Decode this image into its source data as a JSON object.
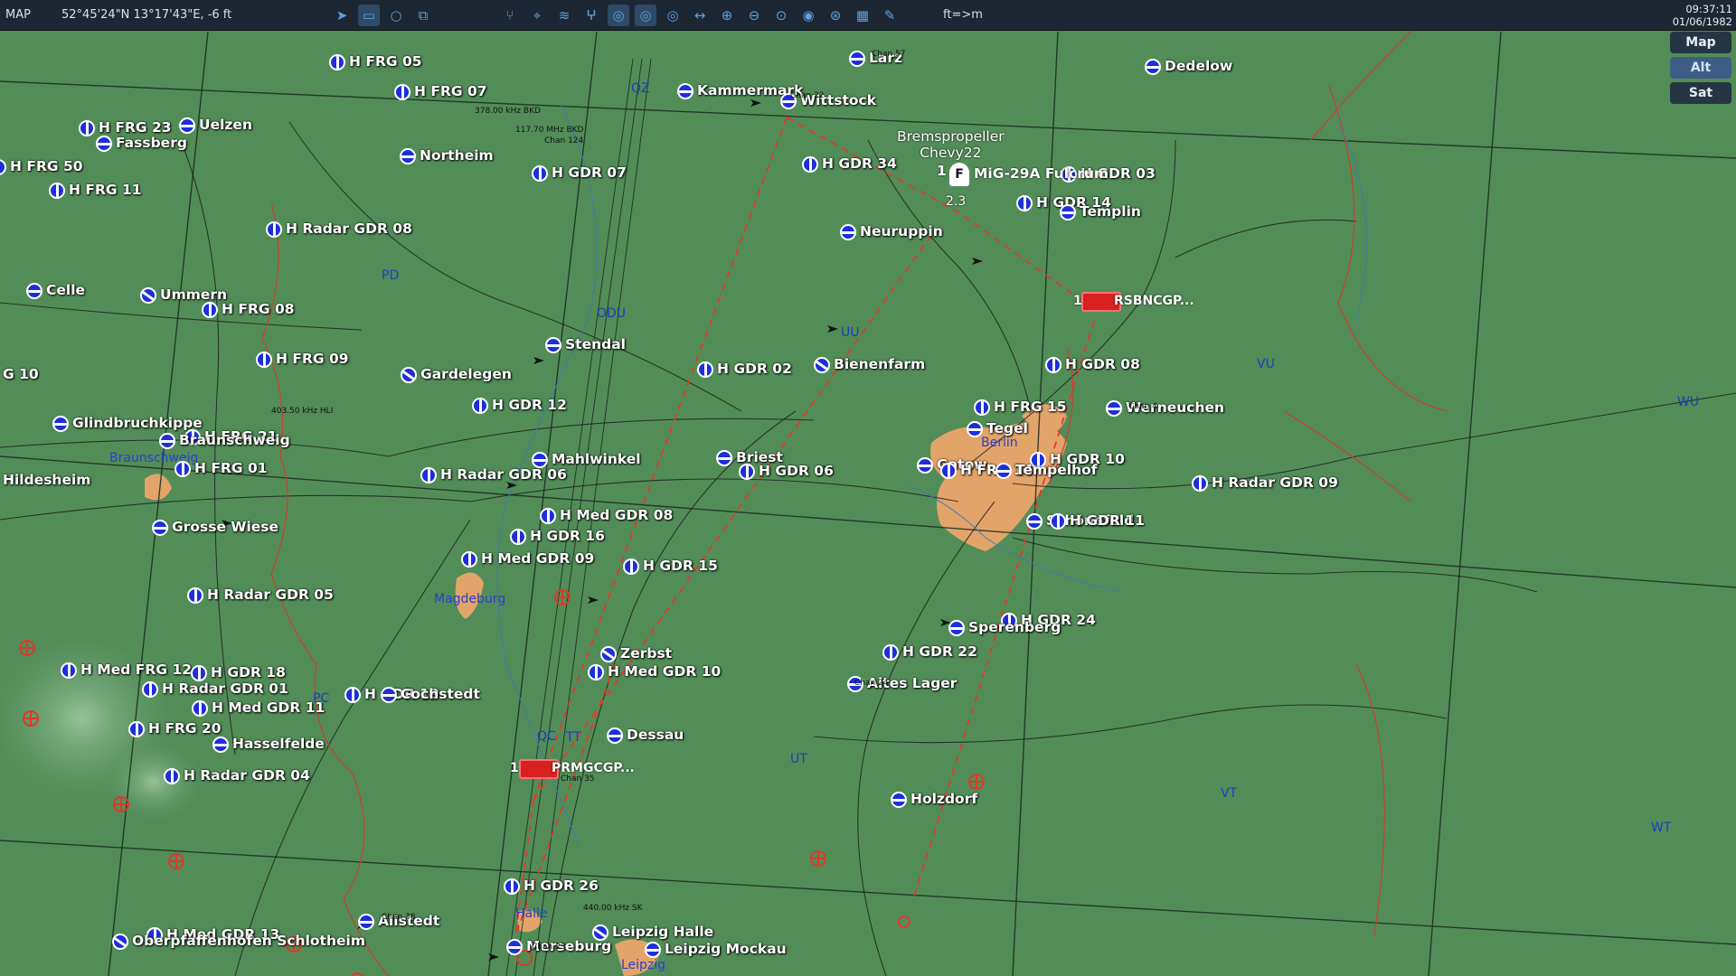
{
  "topbar": {
    "mode_label": "MAP",
    "cursor_coords": "52°45'24\"N 13°17'43\"E, -6 ft",
    "units_toggle": "ft=>m",
    "time": "09:37:11",
    "date": "01/06/1982"
  },
  "toolbar_icons": [
    "send-icon",
    "keyboard-icon",
    "circle-icon",
    "layers-icon",
    "route-icon",
    "target-icon",
    "wifi-icon",
    "antenna-icon",
    "radar-icon",
    "radar2-icon",
    "radar3-icon",
    "ruler-icon",
    "zoom-in-icon",
    "zoom-out-icon",
    "zoom-fit-icon",
    "bullseye-icon",
    "globe-icon",
    "grid-icon",
    "pen-icon"
  ],
  "layer_buttons": {
    "map": "Map",
    "alt": "Alt",
    "sat": "Sat",
    "active": "alt"
  },
  "navaids": [
    {
      "label": "H FRG 05",
      "style": "v"
    },
    {
      "label": "Larz",
      "style": "h"
    },
    {
      "label": "Dedelow",
      "style": "h"
    },
    {
      "label": "H FRG 07",
      "style": "v"
    },
    {
      "label": "Kammermark",
      "style": "h"
    },
    {
      "label": "Wittstock",
      "style": "h"
    },
    {
      "label": "H FRG 23",
      "style": "v"
    },
    {
      "label": "Uelzen",
      "style": "h"
    },
    {
      "label": "Fassberg",
      "style": "h"
    },
    {
      "label": "Northeim",
      "style": "h"
    },
    {
      "label": "H FRG 50",
      "style": "v"
    },
    {
      "label": "H GDR 07",
      "style": "v"
    },
    {
      "label": "H GDR 34",
      "style": "v"
    },
    {
      "label": "H GDR 03",
      "style": "v"
    },
    {
      "label": "H FRG 11",
      "style": "v"
    },
    {
      "label": "H GDR 14",
      "style": "v"
    },
    {
      "label": "Templin",
      "style": "h"
    },
    {
      "label": "H Radar GDR 08",
      "style": "v"
    },
    {
      "label": "Neuruppin",
      "style": "h"
    },
    {
      "label": "Celle",
      "style": "h"
    },
    {
      "label": "Ummern",
      "style": "d"
    },
    {
      "label": "H FRG 08",
      "style": "v"
    },
    {
      "label": "Stendal",
      "style": "h"
    },
    {
      "label": "H FRG 09",
      "style": "v"
    },
    {
      "label": "H GDR 02",
      "style": "v"
    },
    {
      "label": "Bienenfarm",
      "style": "d"
    },
    {
      "label": "H GDR 08",
      "style": "v"
    },
    {
      "label": "Gardelegen",
      "style": "d"
    },
    {
      "label": "G 10",
      "style": "v"
    },
    {
      "label": "H GDR 12",
      "style": "v"
    },
    {
      "label": "H FRG 15",
      "style": "v"
    },
    {
      "label": "Werneuchen",
      "style": "h"
    },
    {
      "label": "Glindbruchkippe",
      "style": "h"
    },
    {
      "label": "Tegel",
      "style": "h"
    },
    {
      "label": "H FRG 21",
      "style": "v"
    },
    {
      "label": "Braunschweig",
      "style": "h"
    },
    {
      "label": "Mahlwinkel",
      "style": "h"
    },
    {
      "label": "Briest",
      "style": "h"
    },
    {
      "label": "H GDR 10",
      "style": "v"
    },
    {
      "label": "H FRG 01",
      "style": "v"
    },
    {
      "label": "H Radar GDR 06",
      "style": "v"
    },
    {
      "label": "H GDR 06",
      "style": "v"
    },
    {
      "label": "Gatow",
      "style": "h"
    },
    {
      "label": "H FRG 14",
      "style": "v"
    },
    {
      "label": "Tempelhof",
      "style": "h"
    },
    {
      "label": "H Radar GDR 09",
      "style": "v"
    },
    {
      "label": "Hildesheim",
      "style": "h"
    },
    {
      "label": "H Med GDR 08",
      "style": "v"
    },
    {
      "label": "Schönefeld",
      "style": "h"
    },
    {
      "label": "H GDR 11",
      "style": "v"
    },
    {
      "label": "Grosse Wiese",
      "style": "h"
    },
    {
      "label": "H GDR 16",
      "style": "v"
    },
    {
      "label": "H Med GDR 09",
      "style": "v"
    },
    {
      "label": "H GDR 15",
      "style": "v"
    },
    {
      "label": "H Radar GDR 05",
      "style": "v"
    },
    {
      "label": "H GDR 24",
      "style": "v"
    },
    {
      "label": "Sperenberg",
      "style": "h"
    },
    {
      "label": "Zerbst",
      "style": "d"
    },
    {
      "label": "H GDR 22",
      "style": "v"
    },
    {
      "label": "H Med FRG 12",
      "style": "v"
    },
    {
      "label": "H GDR 18",
      "style": "v"
    },
    {
      "label": "H Med GDR 10",
      "style": "v"
    },
    {
      "label": "Altes Lager",
      "style": "h"
    },
    {
      "label": "H Radar GDR 01",
      "style": "v"
    },
    {
      "label": "H GDR 19",
      "style": "v"
    },
    {
      "label": "Cochstedt",
      "style": "h"
    },
    {
      "label": "H Med GDR 11",
      "style": "v"
    },
    {
      "label": "H FRG 20",
      "style": "v"
    },
    {
      "label": "Dessau",
      "style": "h"
    },
    {
      "label": "Hasselfelde",
      "style": "h"
    },
    {
      "label": "H Radar GDR 04",
      "style": "v"
    },
    {
      "label": "Holzdorf",
      "style": "h"
    },
    {
      "label": "H GDR 26",
      "style": "v"
    },
    {
      "label": "Allstedt",
      "style": "h"
    },
    {
      "label": "Leipzig Halle",
      "style": "d"
    },
    {
      "label": "H Med GDR 13",
      "style": "v"
    },
    {
      "label": "Oberpfaffenhofen Schlotheim",
      "style": "d"
    },
    {
      "label": "Merseburg",
      "style": "h"
    },
    {
      "label": "Leipzig Mockau",
      "style": "h"
    }
  ],
  "sectors": [
    "PD",
    "ODU",
    "QU",
    "UU",
    "VU",
    "WU",
    "PC",
    "QC",
    "TT",
    "UT",
    "VT",
    "WT",
    "QZ"
  ],
  "cities": [
    "Berlin",
    "Magdeburg",
    "Braunschweig",
    "Leipzig",
    "Halle"
  ],
  "aircraft": {
    "group_name": "Bremspropeller",
    "callsign": "Chevy22",
    "count": "1",
    "type": "MiG-29A Fulcrum",
    "marker": "F",
    "speed": "2.3"
  },
  "units": [
    {
      "count": "1",
      "label": "RSBNCGP..."
    },
    {
      "count": "1",
      "label": "PRMGCGP..."
    }
  ],
  "freq_notes": [
    "378.00 kHz BKD",
    "117.70 MHz BKD",
    "Chan 124",
    "Chan 57",
    "Chan 22",
    "Chan 4",
    "403.50 kHz HLI",
    "440.00 kHz SK",
    "Chan 38",
    "Chan 23",
    "Chan 35",
    "Chan 24"
  ]
}
